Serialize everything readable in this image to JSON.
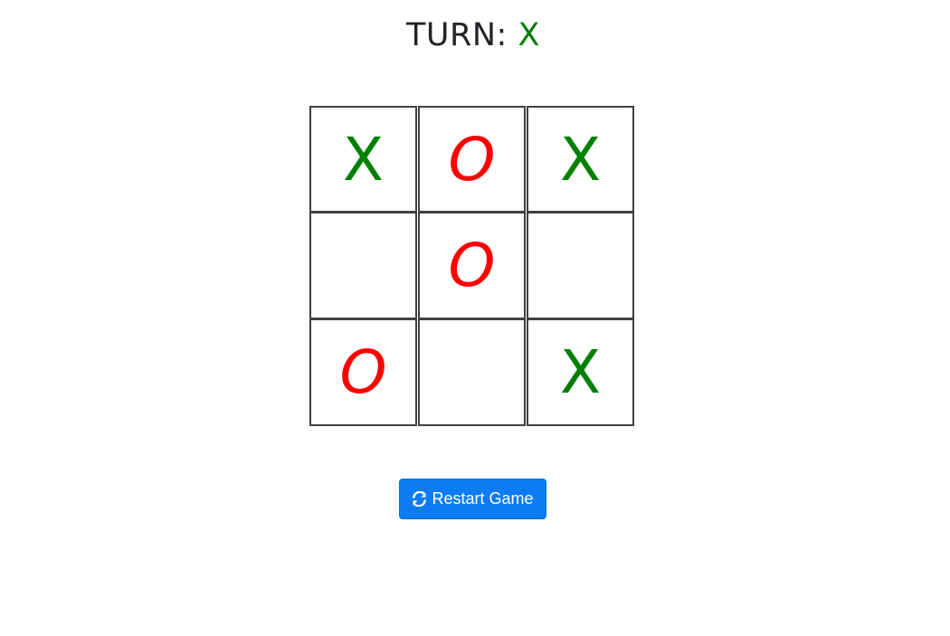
{
  "header": {
    "turn_label": "TURN: ",
    "turn_value": "X"
  },
  "board": {
    "cells": [
      "X",
      "O",
      "X",
      "",
      "O",
      "",
      "O",
      "",
      "X"
    ]
  },
  "colors": {
    "x_mark": "#008000",
    "o_mark": "#ff0000",
    "button_bg": "#0d7cf2"
  },
  "restart_button": {
    "label": "Restart Game",
    "icon": "refresh-icon"
  }
}
